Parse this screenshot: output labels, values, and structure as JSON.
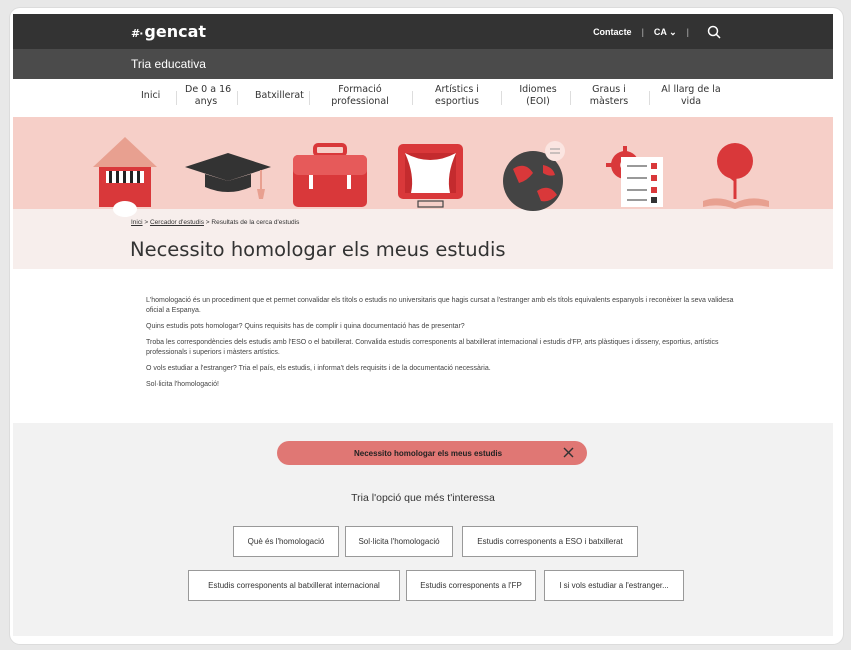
{
  "header": {
    "logo": "gencat",
    "logo_mark": "#·",
    "contact": "Contacte",
    "language": "CA",
    "section_title": "Tria educativa"
  },
  "nav": [
    {
      "label": "Inici"
    },
    {
      "label": "De 0 a 16\nanys"
    },
    {
      "label": "Batxillerat"
    },
    {
      "label": "Formació\nprofessional"
    },
    {
      "label": "Artístics i\nesportius"
    },
    {
      "label": "Idiomes\n(EOI)"
    },
    {
      "label": "Graus i\nmàsters"
    },
    {
      "label": "Al llarg de la\nvida"
    }
  ],
  "breadcrumb": {
    "home": "Inici",
    "search": "Cercador d'estudis",
    "current": "Resultats de la cerca d'estudis"
  },
  "page_title": "Necessito homologar els meus estudis",
  "intro": [
    "L'homologació és un procediment que et permet convalidar els títols o estudis no universitaris que hagis cursat a l'estranger amb els títols equivalents espanyols i reconèixer la seva validesa oficial a Espanya.",
    "Quins estudis pots homologar? Quins requisits has de complir i quina documentació has de presentar?",
    "Troba les correspondències dels estudis amb l'ESO o el batxillerat. Convalida estudis corresponents al batxillerat internacional i estudis d'FP, arts plàstiques i disseny, esportius, artístics professionals i superiors i màsters artístics.",
    "O vols estudiar a l'estranger? Tria el país, els estudis, i informa't dels requisits i de la documentació necessària.",
    "Sol·licita l'homologació!"
  ],
  "filter": {
    "selected": "Necessito homologar els meus estudis",
    "prompt": "Tria l'opció que més t'interessa"
  },
  "options": [
    "Què és l'homologació",
    "Sol·licita l'homologació",
    "Estudis corresponents a ESO i batxillerat",
    "Estudis corresponents al batxillerat internacional",
    "Estudis corresponents a l'FP",
    "I si vols estudiar a l'estranger..."
  ],
  "colors": {
    "header": "#333333",
    "subheader": "#4b4b4b",
    "banner": "#f6cfc8",
    "accent": "#e07774",
    "icon_red": "#d9383a"
  }
}
